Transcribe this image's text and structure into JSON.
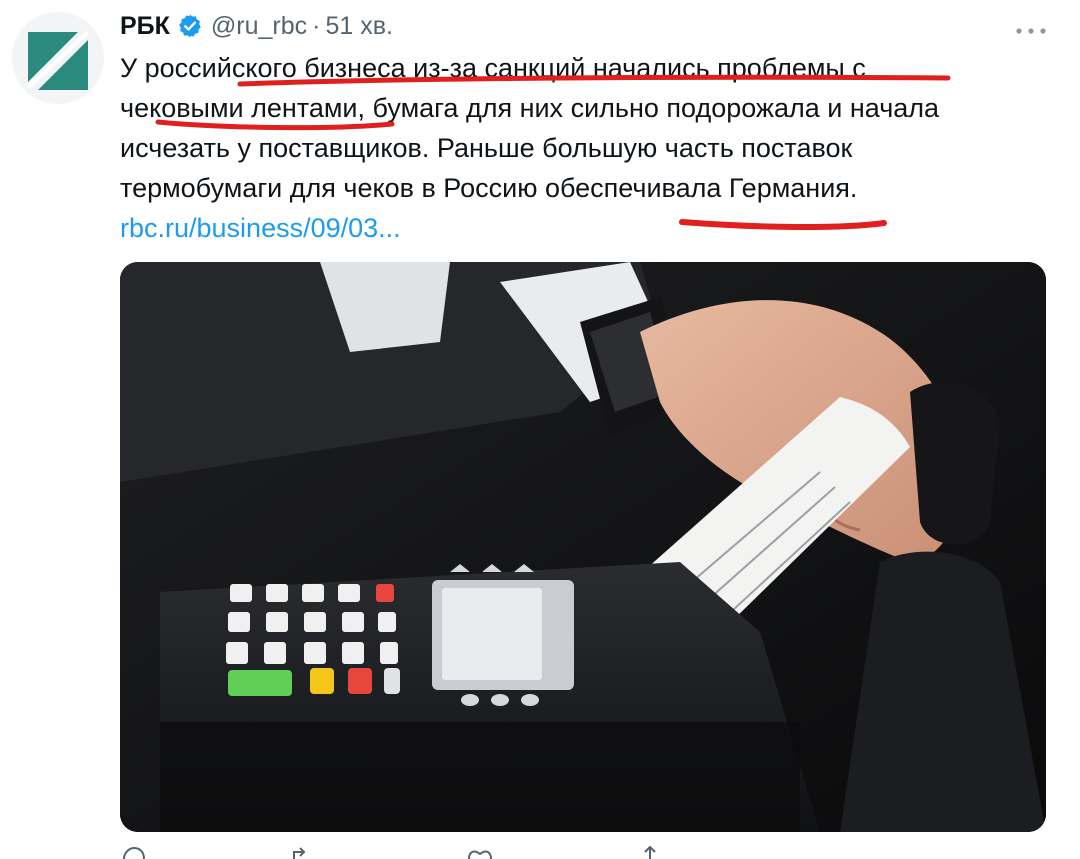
{
  "tweet": {
    "author_name": "РБК",
    "handle": "@ru_rbc",
    "separator": "·",
    "time": "51 хв.",
    "text_lines": [
      "У российского бизнеса из-за санкций начались проблемы с",
      "чековыми лентами, бумага для них сильно подорожала и начала",
      "исчезать у поставщиков. Раньше большую часть поставок",
      "термобумаги для чеков в Россию обеспечивала Германия."
    ],
    "link_text": "rbc.ru/business/09/03..."
  },
  "icons": {
    "avatar": "rbc-logo",
    "verified": "verified-badge-icon",
    "more": "more-options-icon",
    "reply": "reply-icon",
    "retweet": "retweet-icon",
    "like": "like-icon",
    "share": "share-icon"
  },
  "colors": {
    "link": "#1d9bf0",
    "annotation": "#e0201e",
    "secondary_text": "#536471",
    "logo_green": "#2a8a7d"
  }
}
